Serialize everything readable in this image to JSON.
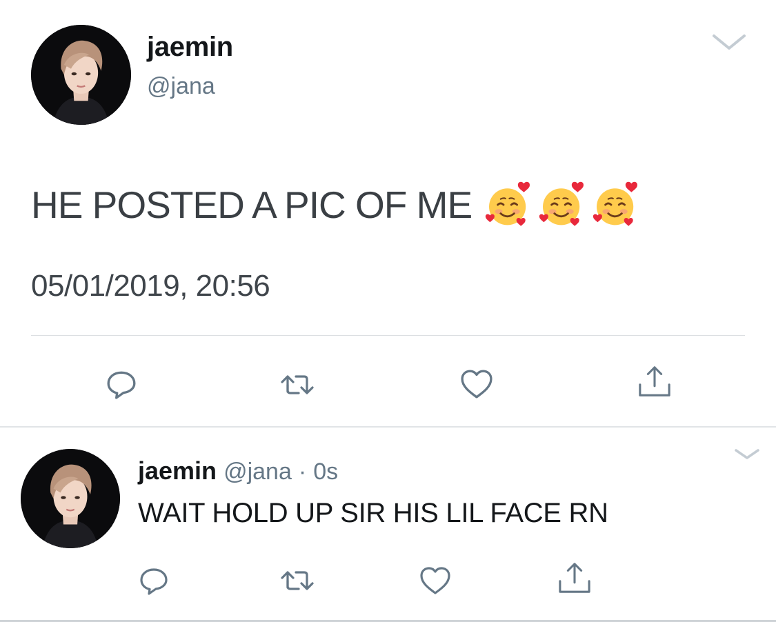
{
  "main_tweet": {
    "display_name": "jaemin",
    "handle": "@jana",
    "text": "HE POSTED A PIC OF ME",
    "emojis": [
      "smiling-face-with-hearts",
      "smiling-face-with-hearts",
      "smiling-face-with-hearts"
    ],
    "timestamp": "05/01/2019, 20:56",
    "actions": [
      "reply-icon",
      "retweet-icon",
      "like-icon",
      "share-icon"
    ]
  },
  "reply_tweet": {
    "display_name": "jaemin",
    "handle": "@jana",
    "separator": "·",
    "time": "0s",
    "text": "WAIT HOLD UP SIR HIS LIL FACE RN",
    "actions": [
      "reply-icon",
      "retweet-icon",
      "like-icon",
      "share-icon"
    ]
  },
  "colors": {
    "text_primary": "#14171a",
    "text_secondary": "#657786",
    "icon_gray": "#657786",
    "divider": "#dcdfe2"
  }
}
